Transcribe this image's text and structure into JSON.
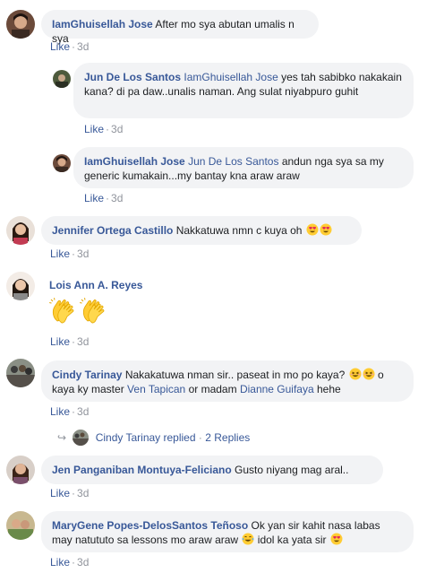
{
  "comments": [
    {
      "author": "IamGhuisellah Jose",
      "text": "After mo sya abutan umalis n sya",
      "like": "Like",
      "time": "3d"
    },
    {
      "author": "Jun De Los Santos",
      "mention": "IamGhuisellah Jose",
      "text": "yes tah sabibko nakakain kana? di pa daw..unalis naman. Ang sulat niyabpuro guhit",
      "like": "Like",
      "time": "3d"
    },
    {
      "author": "IamGhuisellah Jose",
      "mention": "Jun De Los Santos",
      "text": "andun nga sya sa my generic kumakain...my bantay kna araw araw",
      "like": "Like",
      "time": "3d"
    },
    {
      "author": "Jennifer Ortega Castillo",
      "text": "Nakkatuwa nmn c kuya oh",
      "like": "Like",
      "time": "3d"
    },
    {
      "author": "Lois Ann A. Reyes",
      "like": "Like",
      "time": "3d"
    },
    {
      "author": "Cindy Tarinay",
      "text_a": "Nakakatuwa nman sir.. paseat in mo po kaya?",
      "text_b": "o kaya ky master",
      "mention_a": "Ven Tapican",
      "text_c": "or madam",
      "mention_b": "Dianne Guifaya",
      "text_d": "hehe",
      "like": "Like",
      "time": "3d"
    },
    {
      "author": "Jen Panganiban Montuya-Feliciano",
      "text": "Gusto niyang mag aral..",
      "like": "Like",
      "time": "3d"
    },
    {
      "author": "MaryGene Popes-DelosSantos Teñoso",
      "text_a": "Ok yan sir kahit nasa labas may natututo sa lessons mo araw araw",
      "text_b": "idol ka yata sir",
      "like": "Like",
      "time": "3d"
    }
  ],
  "replies_summary": {
    "name": "Cindy Tarinay replied",
    "sep": "·",
    "count": "2 Replies"
  },
  "icons": {
    "reply_arrow": "reply-arrow-icon",
    "heart_eyes": "heart-eyes-emoji",
    "clap": "clapping-hands-emoji",
    "grin": "grinning-squint-emoji",
    "tear_laugh": "tears-of-joy-emoji"
  },
  "colors": {
    "link": "#385898",
    "bubble": "#f2f3f5",
    "meta": "#90949c"
  }
}
